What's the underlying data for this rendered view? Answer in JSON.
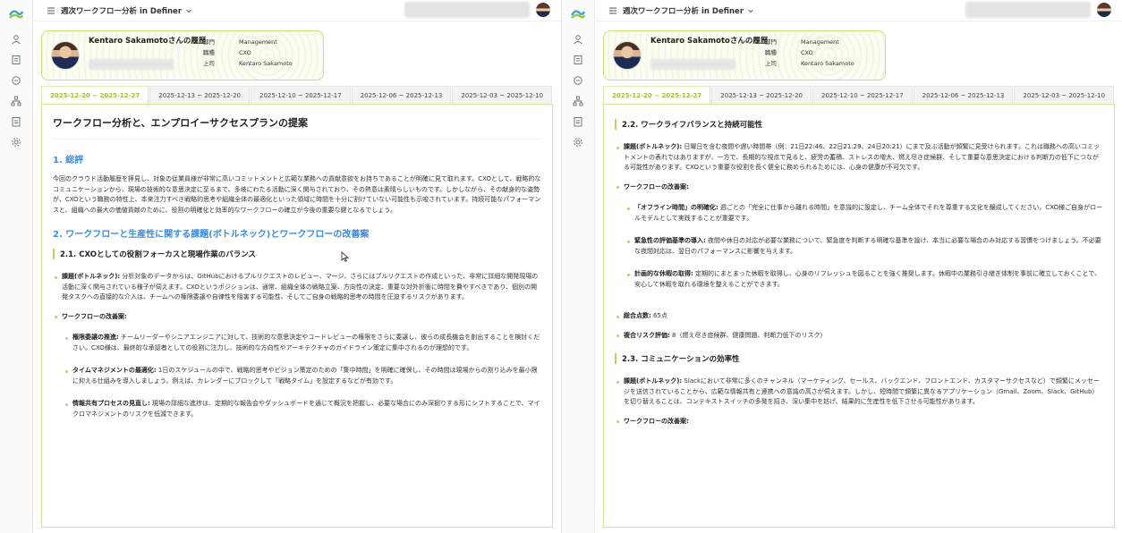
{
  "app": {
    "report_title": "週次ワークフロー分析 in Definer",
    "colors": {
      "accent": "#b5d659",
      "heading_blue": "#3d8bd8",
      "active_tab": "#9cc33b"
    }
  },
  "rail_icons": [
    "user-icon",
    "document-icon",
    "chat-icon",
    "org-chart-icon",
    "clipboard-icon",
    "settings-icon"
  ],
  "profile": {
    "name": "Kentaro Sakamotoさんの履歴",
    "fields": [
      {
        "key": "部門",
        "value": "Management"
      },
      {
        "key": "職種",
        "value": "CXO"
      },
      {
        "key": "上司",
        "value": "Kentaro Sakamoto"
      }
    ]
  },
  "tabs": [
    "2025-12-20 ~ 2025-12-27",
    "2025-12-13 ~ 2025-12-20",
    "2025-12-10 ~ 2025-12-17",
    "2025-12-06 ~ 2025-12-13",
    "2025-12-03 ~ 2025-12-10"
  ],
  "left": {
    "doc_title": "ワークフロー分析と、エンプロイーサクセスプランの提案",
    "section1": {
      "heading": "1. 総評",
      "body": "今回のクラウド活動履歴を拝見し、対象の従業員様が非常に高いコミットメントと広範な業務への貢献意欲をお持ちであることが明確に見て取れます。CXOとして、戦略的なコミュニケーションから、現場の技術的な意思決定に至るまで、多岐にわたる活動に深く関与されており、その熱意は素晴らしいものです。しかしながら、その献身的な姿勢が、CXOという職務の特性上、本来注力すべき戦略的思考や組織全体の最適化といった領域に時間を十分に割けていない可能性も示唆されています。持続可能なパフォーマンスと、組織への最大の価値貢献のために、役割の明確化と効率的なワークフローの確立が今後の重要な鍵となるでしょう。"
    },
    "section2": {
      "heading": "2. ワークフローと生産性に関する課題(ボトルネック)とワークフローの改善案",
      "sub_heading": "2.1. CXOとしての役割フォーカスと現場作業のバランス",
      "issue_label": "課題(ボトルネック):",
      "issue_text": " 分析対象のデータからは、GitHubにおけるプルリクエストのレビュー、マージ、さらにはプルリクエストの作成といった、非常に詳細な開発現場の活動に深く関与されている様子が伺えます。CXOというポジションは、通常、組織全体の戦略立案、方向性の決定、重要な対外折衝に時間を費やすべきであり、個別の開発タスクへの直接的な介入は、チームへの権限委譲や自律性を阻害する可能性、そしてご自身の戦略的思考の時間を圧迫するリスクがあります。",
      "improve_label": "ワークフローの改善案:",
      "items": [
        {
          "label": "権限委譲の推進:",
          "text": " チームリーダーやシニアエンジニアに対して、技術的な意思決定やコードレビューの権限をさらに委譲し、彼らの成長機会を創出することを検討ください。CXO様は、最終的な承認者としての役割に注力し、技術的な方向性やアーキテクチャのガイドライン策定に集中されるのが理想的です。"
        },
        {
          "label": "タイムマネジメントの最適化:",
          "text": " 1日のスケジュールの中で、戦略的思考やビジョン策定のための「集中時間」を明確に確保し、その時間は現場からの割り込みを最小限に抑える仕組みを導入しましょう。例えば、カレンダーにブロックして「戦略タイム」を設定するなどが有効です。"
        },
        {
          "label": "情報共有プロセスの見直し:",
          "text": " 現場の詳細な進捗は、定期的な報告会やダッシュボードを通じて概況を把握し、必要な場合にのみ深掘りする形にシフトすることで、マイクロマネジメントのリスクを低減できます。"
        }
      ]
    }
  },
  "right": {
    "sub_heading_22": "2.2. ワークライフバランスと持続可能性",
    "issue_label": "課題(ボトルネック):",
    "issue_text": " 日曜日を含む夜間や遅い時間帯（例：21日22:46、22日21:29、24日20:21）にまで及ぶ活動が頻繁に見受けられます。これは職務への高いコミットメントの表れではありますが、一方で、長期的な視点で見ると、疲労の蓄積、ストレスの増大、燃え尽き症候群、そして重要な意思決定における判断力の低下につながる可能性があります。CXOという重要な役割を長く健全に務められるためには、心身の健康が不可欠です。",
    "improve_label": "ワークフローの改善案:",
    "items": [
      {
        "label": "「オフライン時間」の明確化:",
        "text": " 週ごとの「完全に仕事から離れる時間」を意識的に設定し、チーム全体でそれを尊重する文化を醸成してください。CXO様ご自身がロールモデルとして実践することが重要です。"
      },
      {
        "label": "緊急性の評価基準の導入:",
        "text": " 夜間や休日の対応が必要な業務について、緊急度を判断する明確な基準を設け、本当に必要な場合のみ対応する習慣をつけましょう。不必要な夜間対応は、翌日のパフォーマンスに影響を与えます。"
      },
      {
        "label": "計画的な休暇の取得:",
        "text": " 定期的にまとまった休暇を取得し、心身のリフレッシュを図ることを強く推奨します。休暇中の業務引き継ぎ体制を事前に確立しておくことで、安心して休暇を取れる環境を整えることができます。"
      }
    ],
    "score_label": "総合点数:",
    "score_value": " 65点",
    "risk_label": "複合リスク評価:",
    "risk_value": " 8（燃え尽き症候群、健康問題、判断力低下のリスク）",
    "sub_heading_23": "2.3. コミュニケーションの効率性",
    "issue2_label": "課題(ボトルネック):",
    "issue2_text": " Slackにおいて非常に多くのチャンネル（マーケティング、セールス、バックエンド、フロントエンド、カスタマーサクセスなど）で頻繁にメッセージを送信されていることから、広範な情報共有と連携への意識の高さが伺えます。しかし、短時間で頻繁に異なるアプリケーション（Gmail、Zoom、Slack、GitHub）を切り替えることは、コンテキストスイッチの多発を招き、深い集中を妨げ、結果的に生産性を低下させる可能性があります。",
    "improve2_label": "ワークフローの改善案:"
  }
}
